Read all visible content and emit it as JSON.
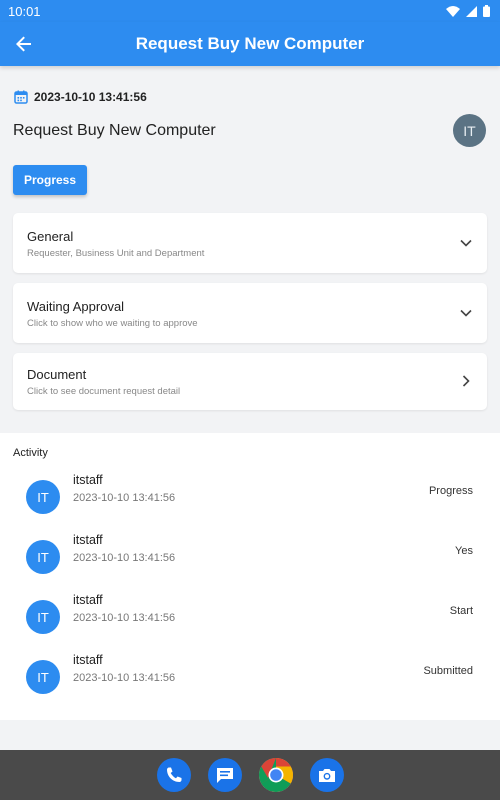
{
  "status_bar": {
    "time": "10:01"
  },
  "app_bar": {
    "title": "Request Buy New Computer"
  },
  "request": {
    "date": "2023-10-10 13:41:56",
    "title": "Request Buy New Computer",
    "avatar_initials": "IT",
    "progress_button": "Progress"
  },
  "sections": [
    {
      "title": "General",
      "subtitle": "Requester, Business Unit and Department",
      "chevron": "chevron-down-icon"
    },
    {
      "title": "Waiting Approval",
      "subtitle": "Click to show who we waiting to approve",
      "chevron": "chevron-down-icon"
    },
    {
      "title": "Document",
      "subtitle": "Click to see document request detail",
      "chevron": "chevron-right-icon"
    }
  ],
  "activity": {
    "header": "Activity",
    "items": [
      {
        "initials": "IT",
        "user": "itstaff",
        "time": "2023-10-10 13:41:56",
        "status": "Progress"
      },
      {
        "initials": "IT",
        "user": "itstaff",
        "time": "2023-10-10 13:41:56",
        "status": "Yes"
      },
      {
        "initials": "IT",
        "user": "itstaff",
        "time": "2023-10-10 13:41:56",
        "status": "Start"
      },
      {
        "initials": "IT",
        "user": "itstaff",
        "time": "2023-10-10 13:41:56",
        "status": "Submitted"
      }
    ]
  },
  "dock": [
    "phone-icon",
    "messages-icon",
    "chrome-icon",
    "camera-icon"
  ],
  "colors": {
    "primary": "#2d8cf0",
    "background": "#f2f3f5",
    "avatar_gray": "#5b7384",
    "dock": "#4a4a4a"
  }
}
